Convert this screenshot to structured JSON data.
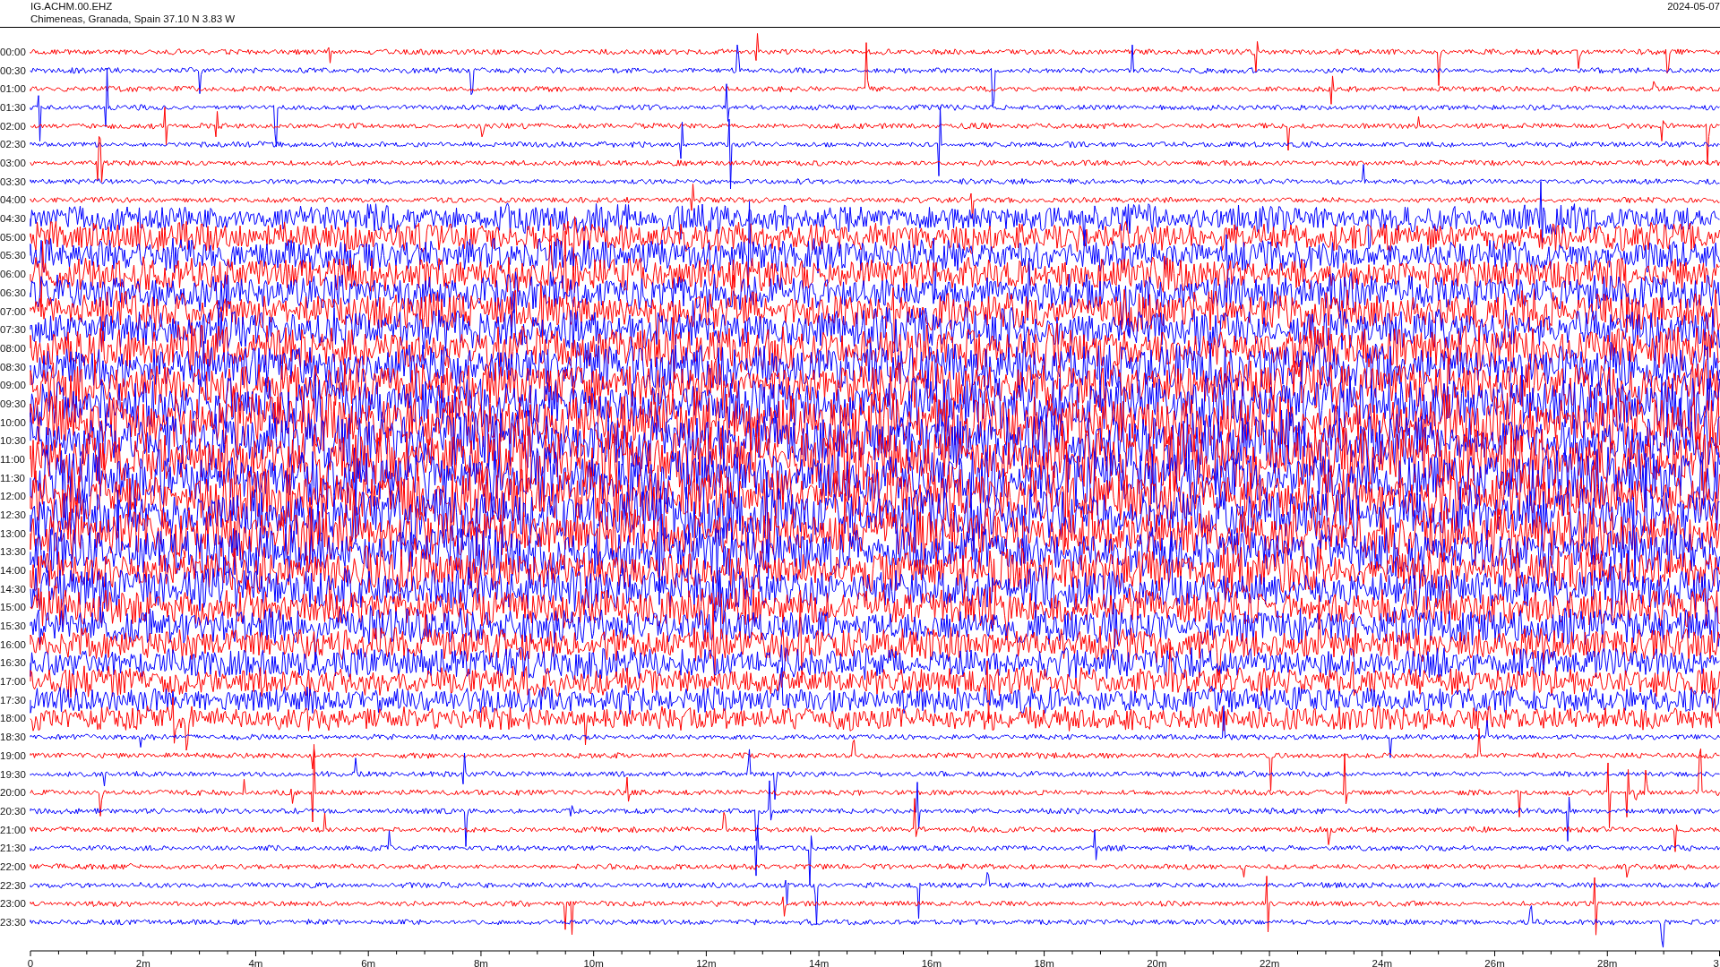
{
  "header": {
    "station": "IG.ACHM.00.EHZ",
    "location": "Chimeneas, Granada, Spain  37.10 N 3.83 W",
    "date": "2024-05-07"
  },
  "rows": [
    {
      "label": "00:00",
      "color": "#ff0000"
    },
    {
      "label": "00:30",
      "color": "#0000ff"
    },
    {
      "label": "01:00",
      "color": "#ff0000"
    },
    {
      "label": "01:30",
      "color": "#0000ff"
    },
    {
      "label": "02:00",
      "color": "#ff0000"
    },
    {
      "label": "02:30",
      "color": "#0000ff"
    },
    {
      "label": "03:00",
      "color": "#ff0000"
    },
    {
      "label": "03:30",
      "color": "#0000ff"
    },
    {
      "label": "04:00",
      "color": "#ff0000"
    },
    {
      "label": "04:30",
      "color": "#0000ff"
    },
    {
      "label": "05:00",
      "color": "#ff0000"
    },
    {
      "label": "05:30",
      "color": "#0000ff"
    },
    {
      "label": "06:00",
      "color": "#ff0000"
    },
    {
      "label": "06:30",
      "color": "#0000ff"
    },
    {
      "label": "07:00",
      "color": "#ff0000"
    },
    {
      "label": "07:30",
      "color": "#0000ff"
    },
    {
      "label": "08:00",
      "color": "#ff0000"
    },
    {
      "label": "08:30",
      "color": "#0000ff"
    },
    {
      "label": "09:00",
      "color": "#ff0000"
    },
    {
      "label": "09:30",
      "color": "#0000ff"
    },
    {
      "label": "10:00",
      "color": "#ff0000"
    },
    {
      "label": "10:30",
      "color": "#0000ff"
    },
    {
      "label": "11:00",
      "color": "#ff0000"
    },
    {
      "label": "11:30",
      "color": "#0000ff"
    },
    {
      "label": "12:00",
      "color": "#ff0000"
    },
    {
      "label": "12:30",
      "color": "#0000ff"
    },
    {
      "label": "13:00",
      "color": "#ff0000"
    },
    {
      "label": "13:30",
      "color": "#0000ff"
    },
    {
      "label": "14:00",
      "color": "#ff0000"
    },
    {
      "label": "14:30",
      "color": "#0000ff"
    },
    {
      "label": "15:00",
      "color": "#ff0000"
    },
    {
      "label": "15:30",
      "color": "#0000ff"
    },
    {
      "label": "16:00",
      "color": "#ff0000"
    },
    {
      "label": "16:30",
      "color": "#0000ff"
    },
    {
      "label": "17:00",
      "color": "#ff0000"
    },
    {
      "label": "17:30",
      "color": "#0000ff"
    },
    {
      "label": "18:00",
      "color": "#ff0000"
    },
    {
      "label": "18:30",
      "color": "#0000ff"
    },
    {
      "label": "19:00",
      "color": "#ff0000"
    },
    {
      "label": "19:30",
      "color": "#0000ff"
    },
    {
      "label": "20:00",
      "color": "#ff0000"
    },
    {
      "label": "20:30",
      "color": "#0000ff"
    },
    {
      "label": "21:00",
      "color": "#ff0000"
    },
    {
      "label": "21:30",
      "color": "#0000ff"
    },
    {
      "label": "22:00",
      "color": "#ff0000"
    },
    {
      "label": "22:30",
      "color": "#0000ff"
    },
    {
      "label": "23:00",
      "color": "#ff0000"
    },
    {
      "label": "23:30",
      "color": "#0000ff"
    }
  ],
  "x_axis": {
    "labels": [
      "0",
      "2m",
      "4m",
      "6m",
      "8m",
      "10m",
      "12m",
      "14m",
      "16m",
      "18m",
      "20m",
      "22m",
      "24m",
      "26m",
      "28m",
      "3"
    ]
  }
}
